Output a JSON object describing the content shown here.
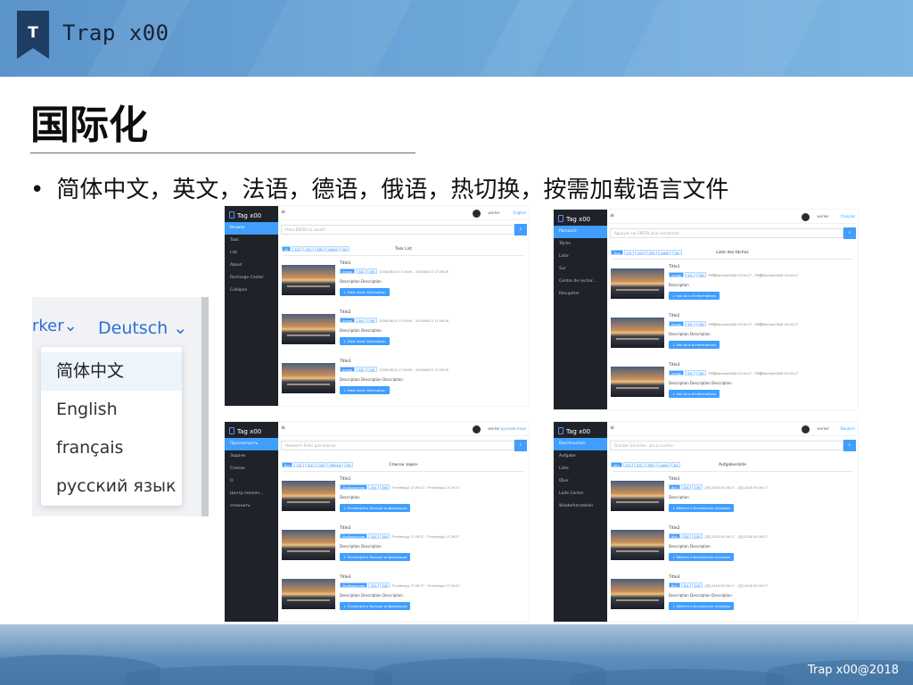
{
  "slide": {
    "brand": "Trap x00",
    "title": "国际化",
    "bullet": "简体中文，英文，法语，德语，俄语，热切换，按需加载语言文件",
    "footer": "Trap x00@2018",
    "logo_letter": "T"
  },
  "dropdown": {
    "user_partial": "rker",
    "current": "Deutsch",
    "options": [
      "简体中文",
      "English",
      "français",
      "русский язык"
    ]
  },
  "shots": [
    {
      "brand": "Tag x00",
      "menu": [
        "Browse",
        "Task",
        "List",
        "About",
        "Recharge Center",
        "Collapse"
      ],
      "user": "worker",
      "lang": "English",
      "search_placeholder": "Press ENTER to search",
      "tags": [
        "All",
        "1/2",
        "3/4",
        "5/6",
        "Label",
        "Ka"
      ],
      "list_title": "Task List",
      "tasks": [
        {
          "title": "Title1",
          "tags": [
            "Image",
            "3/4",
            "5/6"
          ],
          "date": "2018/06/15 17:26:09 - 2018/06/15 17:26:09",
          "desc": "Description Description",
          "more": "↓ View more information"
        },
        {
          "title": "Title2",
          "tags": [
            "Image",
            "3/4",
            "5/6"
          ],
          "date": "2018/06/15 17:26:09 - 2018/06/15 17:26:09",
          "desc": "Description Description",
          "more": "↓ View more information"
        },
        {
          "title": "Title3",
          "tags": [
            "Image",
            "3/4",
            "5/6"
          ],
          "date": "2018/06/15 17:26:09 - 2018/06/15 17:26:09",
          "desc": "Description Description Description",
          "more": "↓ View more information"
        }
      ]
    },
    {
      "brand": "Tag x00",
      "menu": [
        "Parcourir",
        "Tâche",
        "Liste",
        "Sur",
        "Centre de rechar...",
        "Récupérer"
      ],
      "user": "worker",
      "lang": "français",
      "search_placeholder": "Appuyez sur ENTER pour rechercher",
      "tags": [
        "Tous",
        "1/2",
        "3/4",
        "5/6",
        "Label",
        "Ka"
      ],
      "list_title": "Liste des tâches",
      "tasks": [
        {
          "title": "Title1",
          "tags": [
            "Image",
            "3/4",
            "5/6"
          ],
          "date": "PM暗Mpmpm06/J6 05:26:27 - PM暗Mpmpm06/J6 05:26:27",
          "desc": "Description",
          "more": "↓ Voir plus d'informations"
        },
        {
          "title": "Title2",
          "tags": [
            "Image",
            "3/4",
            "5/6"
          ],
          "date": "PM暗Mpmpm06/J6 05:26:27 - PM暗Mpmpm06/J6 05:26:27",
          "desc": "Description Description",
          "more": "↓ Voir plus d'informations"
        },
        {
          "title": "Title3",
          "tags": [
            "Image",
            "3/4",
            "5/6"
          ],
          "date": "PM暗Mpmpm06/J6 05:26:27 - PM暗Mpmpm06/J6 05:26:27",
          "desc": "Description Description Description",
          "more": "↓ Voir plus d'informations"
        }
      ]
    },
    {
      "brand": "Tag x00",
      "menu": [
        "Просмотреть",
        "Задачи",
        "Список",
        "О",
        "Центр пополн...",
        "отменить"
      ],
      "user": "worker",
      "lang": "русский язык",
      "search_placeholder": "Нажмите Enter для поиска",
      "tags": [
        "Все",
        "1/2",
        "3/4",
        "5/6",
        "Метки",
        "Ka"
      ],
      "list_title": "Список задач",
      "tasks": [
        {
          "title": "Title1",
          "tags": [
            "Изображения",
            "3/4",
            "5/6"
          ],
          "date": "Птп/мм/дд 17:26:27 - Птп/мм/дд 17:26:27",
          "desc": "Description",
          "more": "↓ Посмотреть больше информации"
        },
        {
          "title": "Title2",
          "tags": [
            "Изображения",
            "3/4",
            "5/6"
          ],
          "date": "Птп/мм/дд 17:26:27 - Птп/мм/дд 17:26:27",
          "desc": "Description Description",
          "more": "↓ Посмотреть больше информации"
        },
        {
          "title": "Title3",
          "tags": [
            "Изображения",
            "3/4",
            "5/6"
          ],
          "date": "Птп/мм/дд 17:26:27 - Птп/мм/дд 17:26:27",
          "desc": "Description Description Description",
          "more": "↓ Посмотреть больше информации"
        }
      ]
    },
    {
      "brand": "Tag x00",
      "menu": [
        "Durchsuchen",
        "Aufgabe",
        "Liste",
        "Über",
        "Lade Center",
        "Wiederherstellen"
      ],
      "user": "worker",
      "lang": "Deutsch",
      "search_placeholder": "Drücken Sie Enter, um zu suchen",
      "tags": [
        "Alle",
        "1/2",
        "3/4",
        "5/6",
        "Label",
        "Ka"
      ],
      "list_title": "Aufgabenliste",
      "tasks": [
        {
          "title": "Title1",
          "tags": [
            "Bild",
            "3/4",
            "5/6"
          ],
          "date": "{@}2018 05:26:27 - {@}2018 05:26:27",
          "desc": "Description",
          "more": "↓ Weitere Informationen anzeigen"
        },
        {
          "title": "Title2",
          "tags": [
            "Bild",
            "3/4",
            "5/6"
          ],
          "date": "{@}2018 05:26:27 - {@}2018 05:26:27",
          "desc": "Description Description",
          "more": "↓ Weitere Informationen anzeigen"
        },
        {
          "title": "Title3",
          "tags": [
            "Bild",
            "3/4",
            "5/6"
          ],
          "date": "{@}2018 05:26:27 - {@}2018 05:26:27",
          "desc": "Description Description Description",
          "more": "↓ Weitere Informationen anzeigen"
        }
      ]
    }
  ],
  "icons": {
    "logo": "bookmark-badge-icon",
    "chevron": "chevron-down-icon",
    "menu": "hamburger-icon",
    "search": "search-icon"
  },
  "colors": {
    "banner": "#6ba5d8",
    "sidebar": "#1f2329",
    "accent": "#409eff",
    "link": "#2d6fd6"
  }
}
